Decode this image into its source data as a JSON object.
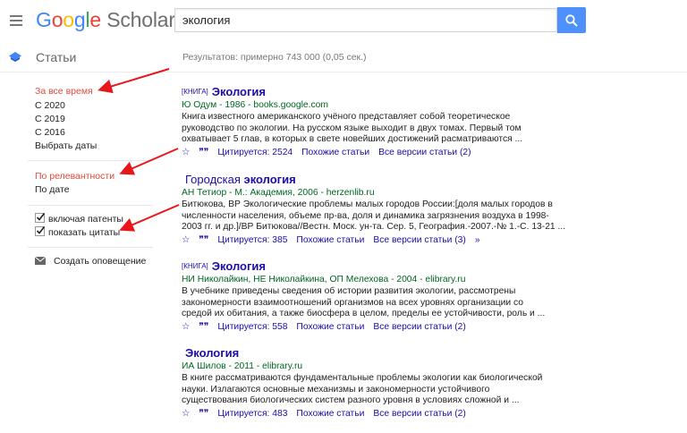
{
  "header": {
    "logo_google": [
      "G",
      "o",
      "o",
      "g",
      "l",
      "e"
    ],
    "logo_scholar": "Scholar",
    "search_value": "экология"
  },
  "subbar": {
    "section_label": "Статьи",
    "results_stats": "Результатов: примерно 743 000 (0,05 сек.)"
  },
  "sidebar": {
    "time_filters": [
      "За все время",
      "С 2020",
      "С 2019",
      "С 2016",
      "Выбрать даты"
    ],
    "sort_options": [
      "По релевантности",
      "По дате"
    ],
    "checkboxes": [
      "включая патенты",
      "показать цитаты"
    ],
    "create_alert": "Создать оповещение"
  },
  "results": [
    {
      "tag": "[КНИГА]",
      "title": "Экология",
      "title_plain": "",
      "source": "Ю Одум - 1986 - books.google.com",
      "snippet": [
        "Книга известного американского учёного представляет собой теоретическое",
        "руководство по экологии. На русском языке выходит в двух томах. Первый том",
        "охватывает 5 глав, в которых в свете новейших достижений расматриваются ..."
      ],
      "cited_by": "Цитируется: 2524",
      "related": "Похожие статьи",
      "versions": "Все версии статьи (2)"
    },
    {
      "tag": "",
      "title": "экология",
      "title_plain": "Городская ",
      "source": "АН Тетиор - М.: Академия, 2006 - herzenlib.ru",
      "snippet": [
        "Битюкова, ВР Экологические проблемы малых городов России:[доля малых городов в",
        "численности населения, объеме пр-ва, доля и динамика загрязнения воздуха в 1998-",
        "2003 гг. и др.]/ВР Битюкова//Вестн. Моск. ун-та. Сер. 5, География.-2007.-№ 1.-С. 13-21 ..."
      ],
      "cited_by": "Цитируется: 385",
      "related": "Похожие статьи",
      "versions": "Все версии статьи (3)"
    },
    {
      "tag": "[КНИГА]",
      "title": "Экология",
      "title_plain": "",
      "source": "НИ Николайкин, НЕ Николайкина, ОП Мелехова - 2004 - elibrary.ru",
      "snippet": [
        "В учебнике приведены сведения об истории развития экологии, рассмотрены",
        "закономерности взаимоотношений организмов на всех уровнях организации со",
        "средой их обитания, а также биосфера в целом, пределы ее устойчивости, роль и ..."
      ],
      "cited_by": "Цитируется: 558",
      "related": "Похожие статьи",
      "versions": "Все версии статьи (2)"
    },
    {
      "tag": "",
      "title": "Экология",
      "title_plain": "",
      "source": "ИА Шилов - 2011 - elibrary.ru",
      "snippet": [
        "В книге рассматриваются фундаментальные проблемы экологии как биологической",
        "науки. Излагаются основные механизмы и закономерности устойчивого",
        "существования биологических систем разного уровня в условиях сложной и ..."
      ],
      "cited_by": "Цитируется: 483",
      "related": "Похожие статьи",
      "versions": "Все версии статьи (2)"
    }
  ],
  "colors": {
    "accent_blue": "#4d90fe",
    "active_red": "#dd4b39",
    "link_blue": "#1a0dab",
    "source_green": "#006621",
    "annotation_arrow": "#e8161b"
  }
}
